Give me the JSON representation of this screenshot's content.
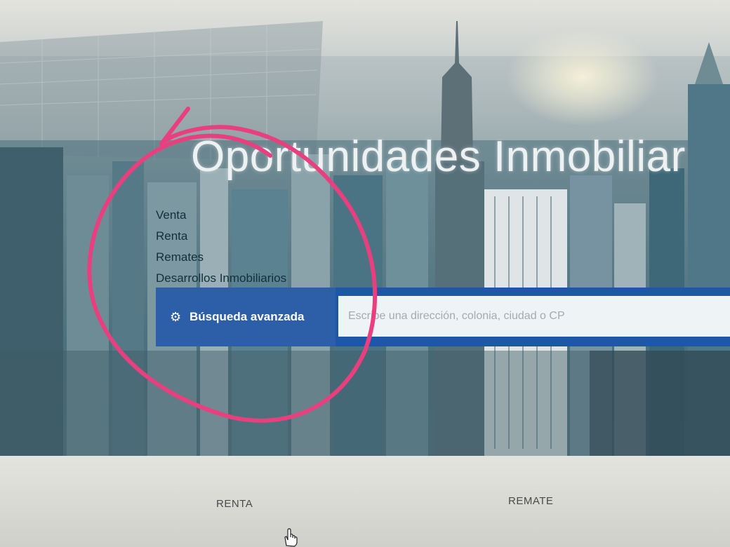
{
  "hero": {
    "title": "Oportunidades Inmobiliar"
  },
  "categories": [
    "Venta",
    "Renta",
    "Remates",
    "Desarrollos Inmobiliarios"
  ],
  "search": {
    "advanced_label": "Búsqueda avanzada",
    "placeholder": "Escribe una dirección, colonia, ciudad o CP"
  },
  "bottom_tabs": {
    "renta": "RENTA",
    "remate": "REMATE"
  },
  "icons": {
    "gear": "gear-icon",
    "cursor": "hand-pointer-icon"
  },
  "colors": {
    "button_blue": "#2d5fa8",
    "input_bg": "#eef3f6",
    "annotation_pink": "#e8407f"
  }
}
